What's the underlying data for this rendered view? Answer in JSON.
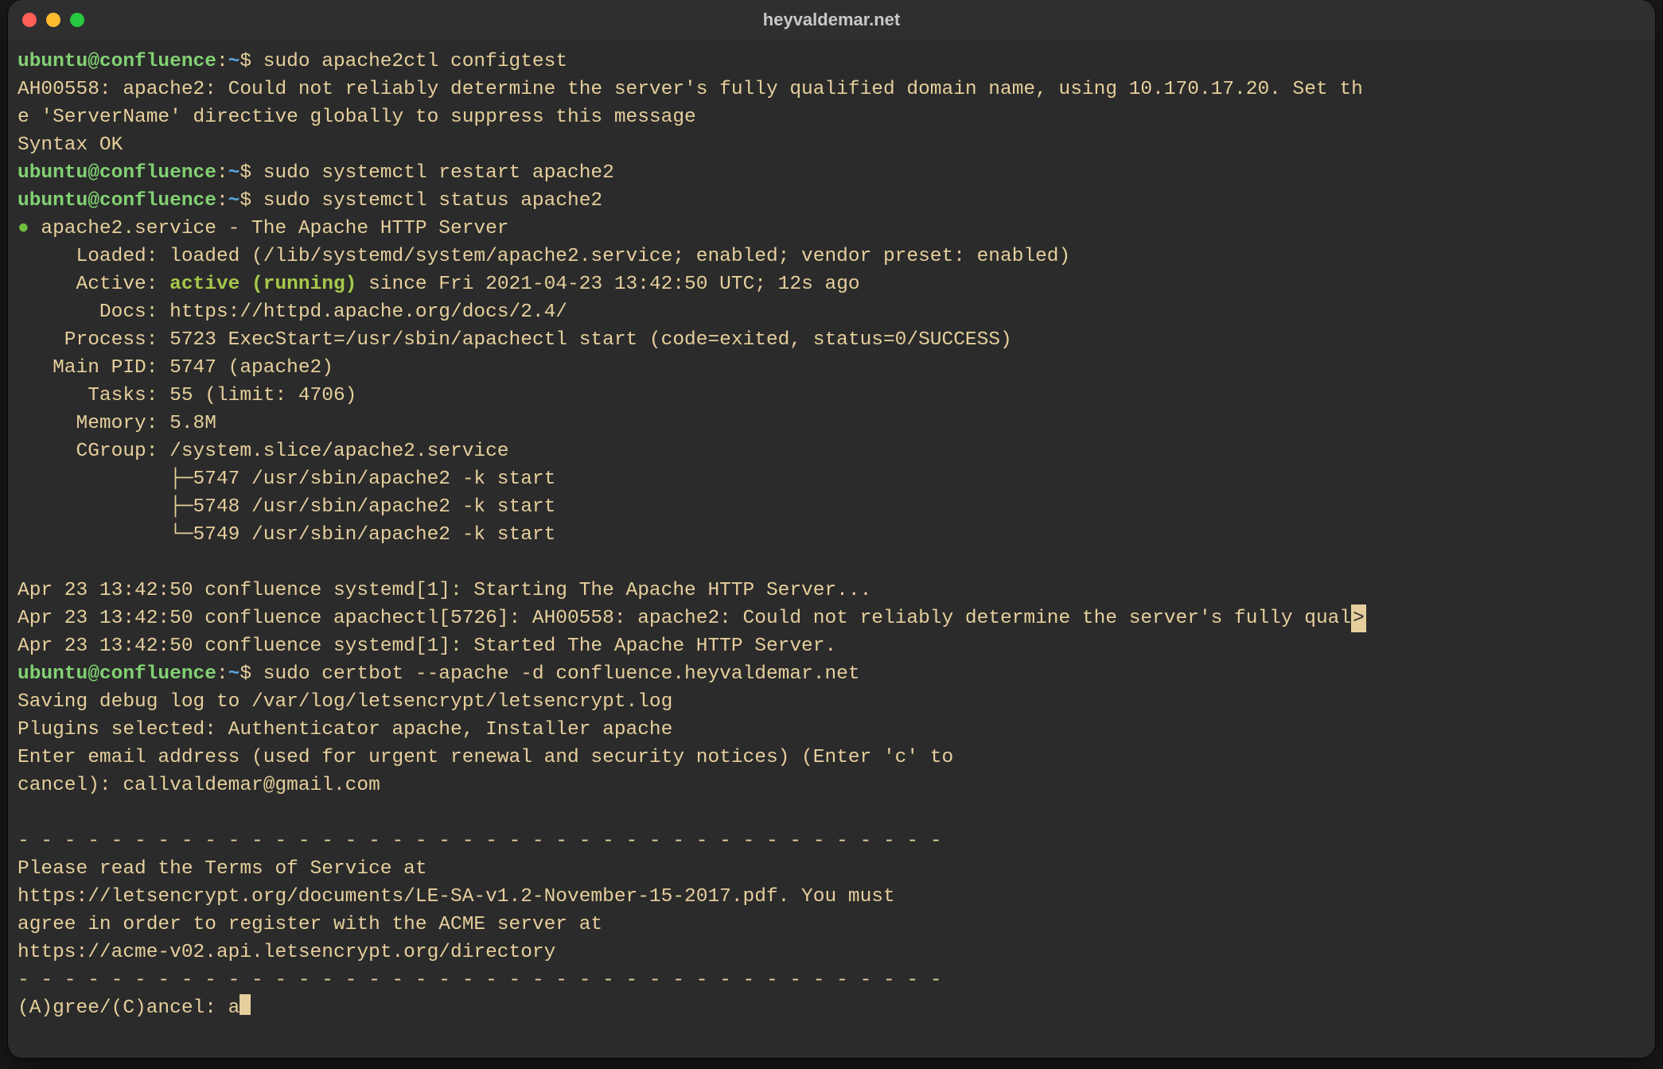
{
  "window": {
    "title": "heyvaldemar.net"
  },
  "prompt": {
    "user": "ubuntu",
    "host": "confluence",
    "path": "~",
    "symbol": "$"
  },
  "cmd": {
    "c1": "sudo apache2ctl configtest",
    "c2": "sudo systemctl restart apache2",
    "c3": "sudo systemctl status apache2",
    "c4": "sudo certbot --apache -d confluence.heyvaldemar.net"
  },
  "out1": {
    "l1": "AH00558: apache2: Could not reliably determine the server's fully qualified domain name, using 10.170.17.20. Set th",
    "l2": "e 'ServerName' directive globally to suppress this message",
    "l3": "Syntax OK"
  },
  "svc": {
    "header": "apache2.service - The Apache HTTP Server",
    "loaded": "     Loaded: loaded (/lib/systemd/system/apache2.service; enabled; vendor preset: enabled)",
    "activeL": "     Active: ",
    "activeV": "active (running)",
    "activeR": " since Fri 2021-04-23 13:42:50 UTC; 12s ago",
    "docs": "       Docs: https://httpd.apache.org/docs/2.4/",
    "process": "    Process: 5723 ExecStart=/usr/sbin/apachectl start (code=exited, status=0/SUCCESS)",
    "mainpid": "   Main PID: 5747 (apache2)",
    "tasks": "      Tasks: 55 (limit: 4706)",
    "memory": "     Memory: 5.8M",
    "cgroup": "     CGroup: /system.slice/apache2.service",
    "t1": "             ├─5747 /usr/sbin/apache2 -k start",
    "t2": "             ├─5748 /usr/sbin/apache2 -k start",
    "t3": "             └─5749 /usr/sbin/apache2 -k start"
  },
  "log": {
    "l1": "Apr 23 13:42:50 confluence systemd[1]: Starting The Apache HTTP Server...",
    "l2a": "Apr 23 13:42:50 confluence apachectl[5726]: AH00558: apache2: Could not reliably determine the server's fully qual",
    "l2b": ">",
    "l3": "Apr 23 13:42:50 confluence systemd[1]: Started The Apache HTTP Server."
  },
  "cert": {
    "l1": "Saving debug log to /var/log/letsencrypt/letsencrypt.log",
    "l2": "Plugins selected: Authenticator apache, Installer apache",
    "l3": "Enter email address (used for urgent renewal and security notices) (Enter 'c' to",
    "l4": "cancel): callvaldemar@gmail.com",
    "sep1": "- - - - - - - - - - - - - - - - - - - - - - - - - - - - - - - - - - - - - - - -",
    "t1": "Please read the Terms of Service at",
    "t2": "https://letsencrypt.org/documents/LE-SA-v1.2-November-15-2017.pdf. You must",
    "t3": "agree in order to register with the ACME server at",
    "t4": "https://acme-v02.api.letsencrypt.org/directory",
    "sep2": "- - - - - - - - - - - - - - - - - - - - - - - - - - - - - - - - - - - - - - - -",
    "promptLabel": "(A)gree/(C)ancel: ",
    "promptInput": "a"
  }
}
